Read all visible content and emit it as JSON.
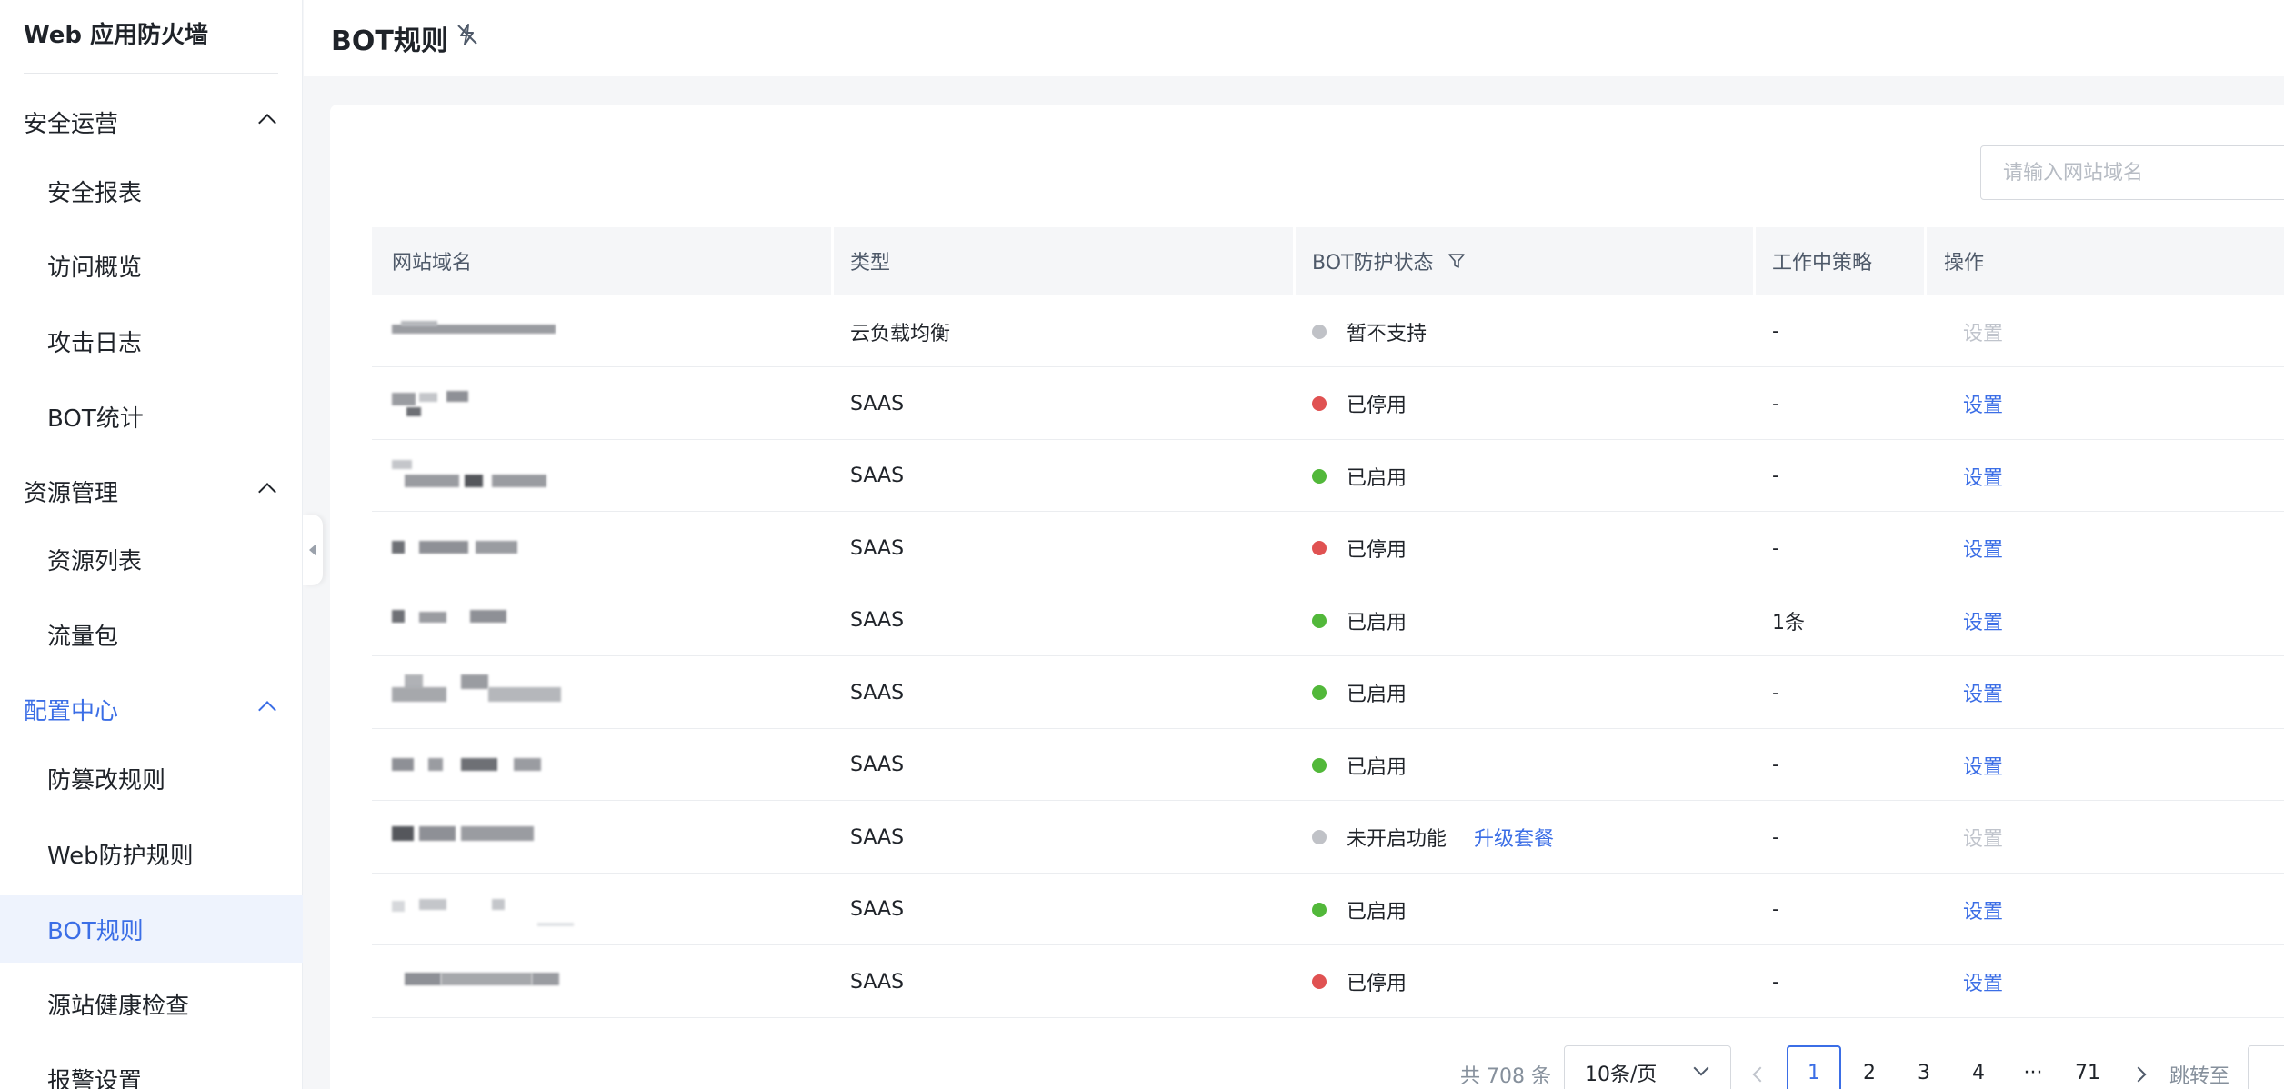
{
  "app_title": "Web 应用防火墙",
  "sidebar": {
    "groups": [
      {
        "label": "安全运营",
        "items": [
          "安全报表",
          "访问概览",
          "攻击日志",
          "BOT统计"
        ]
      },
      {
        "label": "资源管理",
        "items": [
          "资源列表",
          "流量包"
        ]
      },
      {
        "label": "配置中心",
        "items": [
          "防篡改规则",
          "Web防护规则",
          "BOT规则",
          "源站健康检查",
          "报警设置"
        ]
      }
    ],
    "selected_item": "BOT规则"
  },
  "header": {
    "title": "BOT规则"
  },
  "search": {
    "placeholder": "请输入网站域名"
  },
  "table": {
    "columns": [
      "网站域名",
      "类型",
      "BOT防护状态",
      "工作中策略",
      "操作"
    ],
    "rows": [
      {
        "type": "云负载均衡",
        "status": "暂不支持",
        "status_color": "#c0c2c7",
        "policy": "-",
        "action": "设置",
        "action_enabled": false
      },
      {
        "type": "SAAS",
        "status": "已停用",
        "status_color": "#e05252",
        "policy": "-",
        "action": "设置",
        "action_enabled": true
      },
      {
        "type": "SAAS",
        "status": "已启用",
        "status_color": "#52b83a",
        "policy": "-",
        "action": "设置",
        "action_enabled": true
      },
      {
        "type": "SAAS",
        "status": "已停用",
        "status_color": "#e05252",
        "policy": "-",
        "action": "设置",
        "action_enabled": true
      },
      {
        "type": "SAAS",
        "status": "已启用",
        "status_color": "#52b83a",
        "policy": "1条",
        "action": "设置",
        "action_enabled": true
      },
      {
        "type": "SAAS",
        "status": "已启用",
        "status_color": "#52b83a",
        "policy": "-",
        "action": "设置",
        "action_enabled": true
      },
      {
        "type": "SAAS",
        "status": "已启用",
        "status_color": "#52b83a",
        "policy": "-",
        "action": "设置",
        "action_enabled": true
      },
      {
        "type": "SAAS",
        "status": "未开启功能",
        "status_color": "#c0c2c7",
        "upgrade": "升级套餐",
        "policy": "-",
        "action": "设置",
        "action_enabled": false
      },
      {
        "type": "SAAS",
        "status": "已启用",
        "status_color": "#52b83a",
        "policy": "-",
        "action": "设置",
        "action_enabled": true
      },
      {
        "type": "SAAS",
        "status": "已停用",
        "status_color": "#e05252",
        "policy": "-",
        "action": "设置",
        "action_enabled": true
      }
    ]
  },
  "pagination": {
    "total": "共 708 条",
    "page_size": "10条/页",
    "pages": [
      "1",
      "2",
      "3",
      "4",
      "···",
      "71"
    ],
    "current": "1",
    "jump_label": "跳转至"
  },
  "colors": {
    "accent": "#3b6ee6",
    "enabled": "#52b83a",
    "disabled": "#e05252",
    "neutral": "#c0c2c7"
  }
}
